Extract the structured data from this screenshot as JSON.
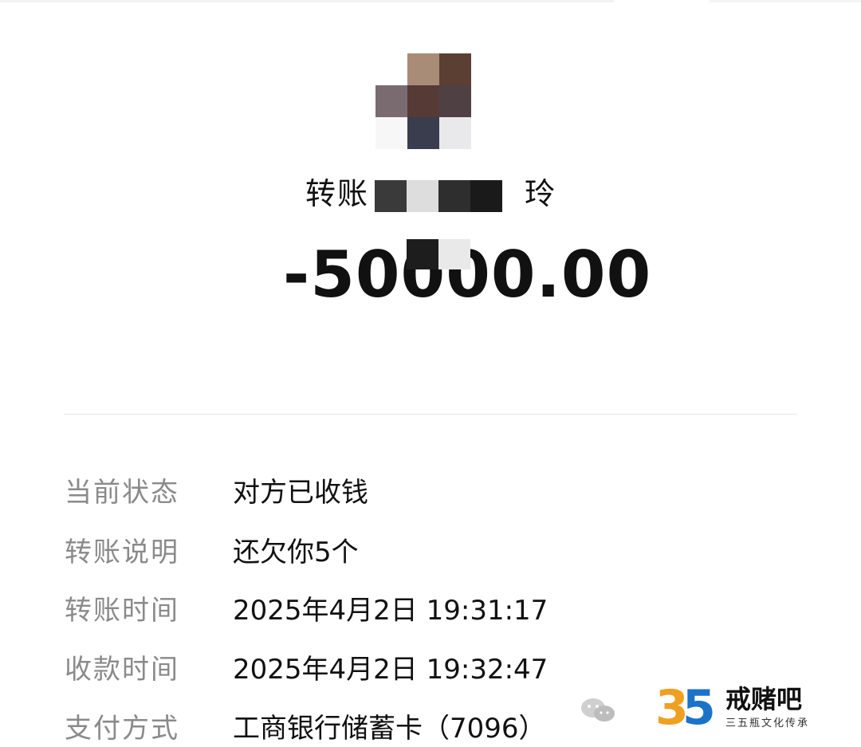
{
  "header": {
    "title_prefix": "转账",
    "title_suffix": "玲",
    "amount": "-50000.00",
    "avatar_colors": [
      [
        "#ffffff",
        "#a98c78",
        "#5a3f32"
      ],
      [
        "#7a6b70",
        "#553a36",
        "#4f4043"
      ],
      [
        "#f7f7f7",
        "#3a3d4d",
        "#e9e8ea"
      ]
    ],
    "name_mask_colors": [
      "#3a3a3a",
      "#dddddd",
      "#2e2e2e",
      "#1a1a1a"
    ],
    "amount_mask_colors": [
      "#1d1d1d",
      "#e9e9e9"
    ]
  },
  "details": {
    "rows": [
      {
        "label": "当前状态",
        "value": "对方已收钱"
      },
      {
        "label": "转账说明",
        "value": "还欠你5个"
      },
      {
        "label": "转账时间",
        "value": "2025年4月2日 19:31:17"
      },
      {
        "label": "收款时间",
        "value": "2025年4月2日 19:32:47"
      },
      {
        "label": "支付方式",
        "value": "工商银行储蓄卡（7096）"
      }
    ]
  },
  "watermark": {
    "brand": "戒赌吧",
    "tagline": "三五瓶文化传承",
    "logo_text": "35",
    "icon": "wechat-icon",
    "accent": "#1a73c9",
    "accent2": "#f0a020"
  }
}
